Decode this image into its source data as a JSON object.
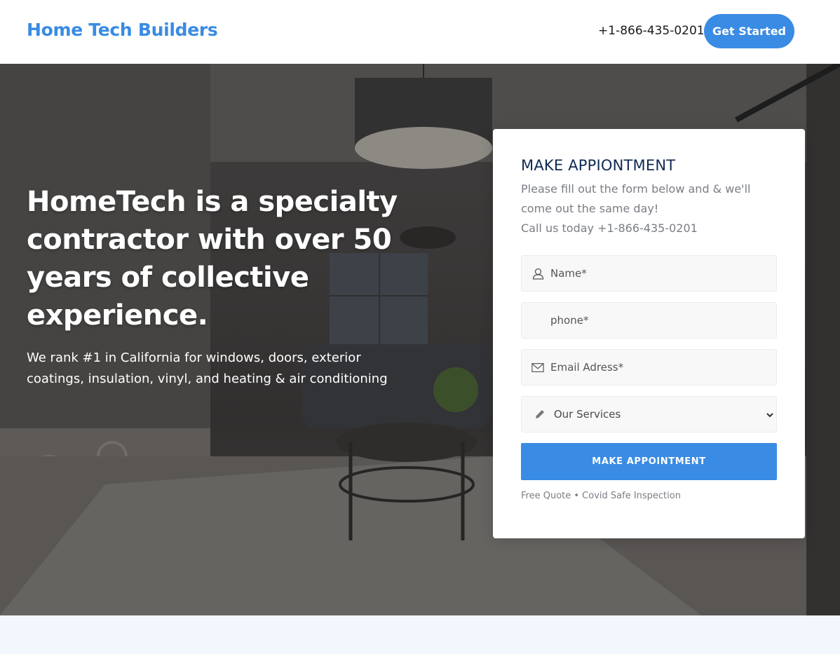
{
  "header": {
    "brand": "Home Tech Builders",
    "phone": "+1-866-435-0201",
    "cta_label": "Get Started",
    "accent_color": "#3a8be3"
  },
  "hero": {
    "title": "HomeTech is a specialty contractor with over 50 years of collective experience.",
    "subtitle": "We rank #1 in California for windows, doors, exterior coatings, insulation, vinyl, and heating & air conditioning"
  },
  "form": {
    "title": "MAKE APPIONTMENT",
    "description_line1": "Please fill out the form below and & we'll come out the same day!",
    "description_line2": "Call us today +1-866-435-0201",
    "name_placeholder": "Name*",
    "phone_placeholder": "phone*",
    "email_placeholder": "Email Adress*",
    "services_selected": "Our Services",
    "submit_label": "MAKE APPOINTMENT",
    "footer_note": "Free Quote • Covid Safe Inspection",
    "icons": [
      "user-icon",
      "mail-icon",
      "pencil-icon",
      "chevron-down-icon"
    ]
  }
}
